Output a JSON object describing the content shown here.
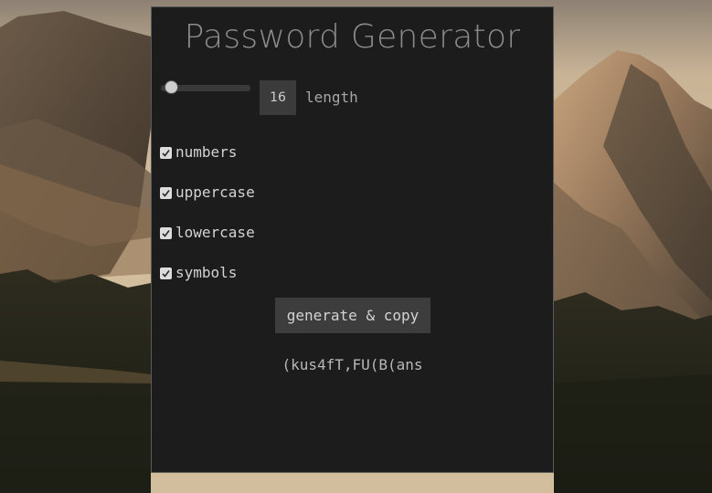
{
  "app": {
    "title": "Password Generator"
  },
  "length": {
    "value": "16",
    "label": "length",
    "slider_fraction": 0.05
  },
  "options": [
    {
      "label": "numbers",
      "checked": true
    },
    {
      "label": "uppercase",
      "checked": true
    },
    {
      "label": "lowercase",
      "checked": true
    },
    {
      "label": "symbols",
      "checked": true
    }
  ],
  "actions": {
    "generate_label": "generate & copy"
  },
  "output": {
    "password": "(kus4fT,FU(B(ans"
  },
  "colors": {
    "window_bg": "#1c1c1c",
    "control_bg": "#3b3b3b",
    "text": "#d3d3d3",
    "title": "#8b8b8b"
  },
  "icons": {
    "checkbox": "check-icon"
  }
}
